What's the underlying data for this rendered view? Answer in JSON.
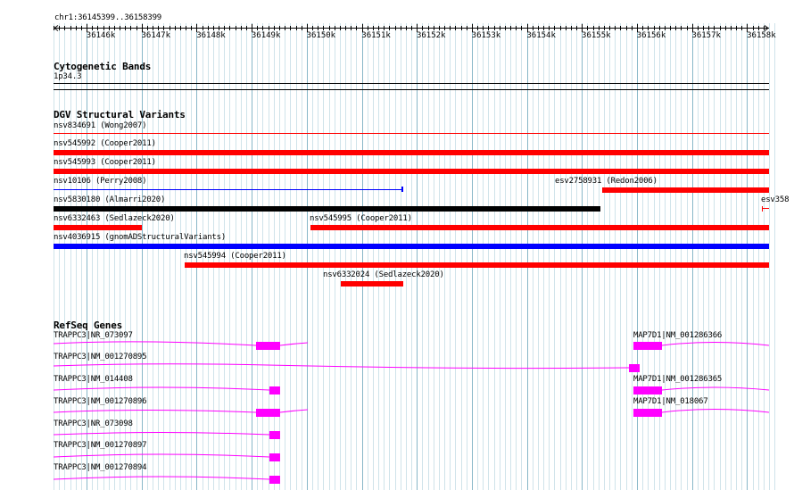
{
  "ruler": {
    "location": "chr1:36145399..36158399",
    "ticks": [
      "36146k",
      "36147k",
      "36148k",
      "36149k",
      "36150k",
      "36151k",
      "36152k",
      "36153k",
      "36154k",
      "36155k",
      "36156k",
      "36157k",
      "36158k"
    ]
  },
  "cytobands": {
    "title": "Cytogenetic Bands",
    "band": "1p34.3"
  },
  "dgv": {
    "title": "DGV Structural Variants",
    "features": [
      {
        "id": "nsv834691 (Wong2007)",
        "color": "#ff0000",
        "start": 36145399,
        "end": 36158399,
        "style": "thin"
      },
      {
        "id": "nsv545992 (Cooper2011)",
        "color": "#ff0000",
        "start": 36145399,
        "end": 36158399,
        "style": "thick"
      },
      {
        "id": "nsv545993 (Cooper2011)",
        "color": "#ff0000",
        "start": 36145399,
        "end": 36158399,
        "style": "thick"
      },
      {
        "id": "nsv10106 (Perry2008)",
        "color": "#0000ff",
        "start": 36145399,
        "end": 36151720,
        "style": "thin-end"
      },
      {
        "id": "esv2758931 (Redon2006)",
        "color": "#ff0000",
        "start": 36155375,
        "end": 36158399,
        "style": "thick"
      },
      {
        "id": "nsv5830180 (Almarri2020)",
        "color": "#000000",
        "start": 36145399,
        "end": 36155330,
        "style": "thick"
      },
      {
        "id": "esv358",
        "color": "#ff0000",
        "start": 36158370,
        "end": 36158399,
        "style": "tick"
      },
      {
        "id": "nsv6332463 (Sedlazeck2020)",
        "color": "#ff0000",
        "start": 36145399,
        "end": 36147000,
        "style": "thick"
      },
      {
        "id": "nsv545995 (Cooper2011)",
        "color": "#ff0000",
        "start": 36150060,
        "end": 36158399,
        "style": "thick"
      },
      {
        "id": "nsv4036915 (gnomADStructuralVariants)",
        "color": "#0000ff",
        "start": 36145399,
        "end": 36158399,
        "style": "thick"
      },
      {
        "id": "nsv545994 (Cooper2011)",
        "color": "#ff0000",
        "start": 36147780,
        "end": 36158399,
        "style": "thick"
      },
      {
        "id": "nsv6332024 (Sedlazeck2020)",
        "color": "#ff0000",
        "start": 36150620,
        "end": 36151750,
        "style": "thick"
      }
    ]
  },
  "genes": {
    "title": "RefSeq Genes",
    "color": "#ff00ff",
    "trappc3": [
      {
        "label": "TRAPPC3|NR_073097"
      },
      {
        "label": "TRAPPC3|NM_001270895"
      },
      {
        "label": "TRAPPC3|NM_014408"
      },
      {
        "label": "TRAPPC3|NM_001270896"
      },
      {
        "label": "TRAPPC3|NR_073098"
      },
      {
        "label": "TRAPPC3|NM_001270897"
      },
      {
        "label": "TRAPPC3|NM_001270894"
      }
    ],
    "map7d1": [
      {
        "label": "MAP7D1|NM_001286366"
      },
      {
        "label": "MAP7D1|NM_001286365"
      },
      {
        "label": "MAP7D1|NM_018067"
      }
    ]
  }
}
